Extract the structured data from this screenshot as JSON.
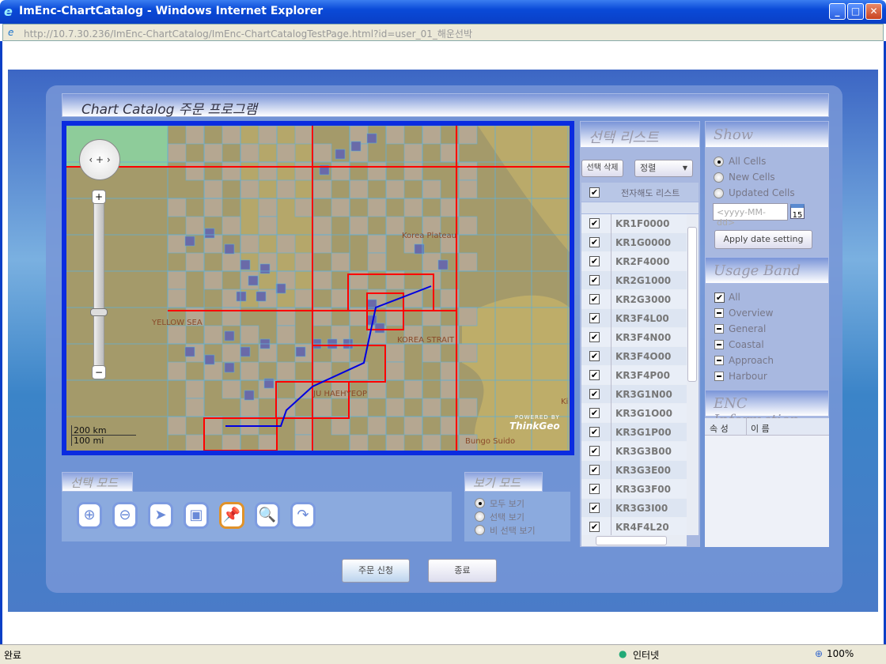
{
  "window": {
    "title": "ImEnc-ChartCatalog - Windows Internet Explorer",
    "url_host": "http://10.7.30.236",
    "url_path": "/ImEnc-ChartCatalog/ImEnc-ChartCatalogTestPage.html?id=user_01_해운선박",
    "min": "_",
    "max": "□",
    "close": "✕"
  },
  "app": {
    "title": "Chart Catalog 주문 프로그램"
  },
  "map": {
    "labels": [
      "YELLOW SEA",
      "Korea Plateau",
      "KOREA STRAIT",
      "JU HAEHYEOP",
      "Bungo Suido",
      "Ki"
    ],
    "scale_km": "200 km",
    "scale_mi": "100 mi",
    "powered_by": "POWERED BY",
    "brand": "ThinkGeo",
    "pan": "‹ + ›",
    "zoom_in": "+",
    "zoom_out": "−",
    "colors": {
      "land": "#a49a6a",
      "cell": "#b5a791",
      "selected_cell": "#6a6aa8",
      "grid": "#5fb0d8",
      "selected_band": "#ff0000",
      "route": "#0000e0",
      "green": "#8ecc9a"
    }
  },
  "list": {
    "title": "선택 리스트",
    "delete_button": "선택 삭제",
    "sort_select": "정렬",
    "column_header": "전자해도 리스트",
    "items": [
      "KR1F0000",
      "KR1G0000",
      "KR2F4000",
      "KR2G1000",
      "KR2G3000",
      "KR3F4L00",
      "KR3F4N00",
      "KR3F4O00",
      "KR3F4P00",
      "KR3G1N00",
      "KR3G1O00",
      "KR3G1P00",
      "KR3G3B00",
      "KR3G3E00",
      "KR3G3F00",
      "KR3G3I00",
      "KR4F4L20"
    ]
  },
  "show": {
    "title": "Show",
    "options": [
      "All Cells",
      "New Cells",
      "Updated Cells"
    ],
    "selected": "All Cells",
    "date_placeholder": "<yyyy-MM-dd>",
    "calendar_day": "15",
    "apply_button": "Apply date setting"
  },
  "usage_band": {
    "title": "Usage Band",
    "items": [
      "All",
      "Overview",
      "General",
      "Coastal",
      "Approach",
      "Harbour"
    ]
  },
  "enc_info": {
    "title": "ENC Information",
    "col_attr": "속 성",
    "col_name": "이 름"
  },
  "selection_mode": {
    "title": "선택 모드",
    "tools": [
      "zoom-in",
      "zoom-out",
      "select",
      "rectangle",
      "pin",
      "globe-search",
      "redo"
    ],
    "active": "pin"
  },
  "view_mode": {
    "title": "보기 모드",
    "options": [
      "모두 보기",
      "선택 보기",
      "비 선택 보기"
    ],
    "selected": "모두 보기"
  },
  "actions": {
    "order": "주문 신청",
    "exit": "종료"
  },
  "statusbar": {
    "status": "완료",
    "zone": "인터넷",
    "zoom": "100%"
  }
}
